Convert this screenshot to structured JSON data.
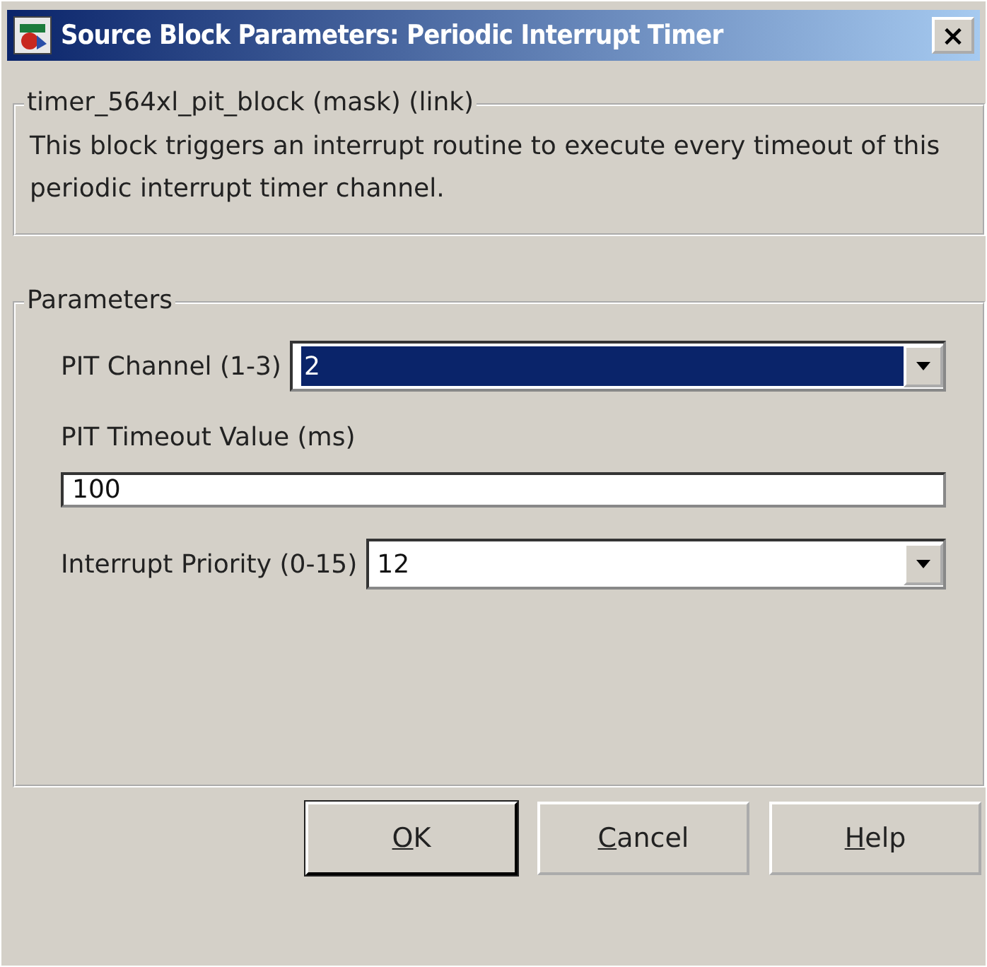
{
  "window": {
    "title": "Source Block Parameters: Periodic Interrupt Timer",
    "close": "×"
  },
  "description": {
    "legend": "timer_564xl_pit_block (mask) (link)",
    "text": "This block triggers an interrupt routine to execute every timeout of this periodic interrupt timer channel."
  },
  "parameters": {
    "legend": "Parameters",
    "fields": [
      {
        "kind": "dropdown",
        "label": "PIT Channel (1-3)",
        "value": "2",
        "selected": true
      },
      {
        "kind": "text",
        "label": "PIT Timeout Value (ms)",
        "value": "100",
        "selected": false
      },
      {
        "kind": "dropdown",
        "label": "Interrupt Priority (0-15)",
        "value": "12",
        "selected": false
      }
    ]
  },
  "buttons": [
    {
      "label": "OK",
      "default": true
    },
    {
      "label": "Cancel",
      "default": false
    },
    {
      "label": "Help",
      "default": false
    }
  ]
}
